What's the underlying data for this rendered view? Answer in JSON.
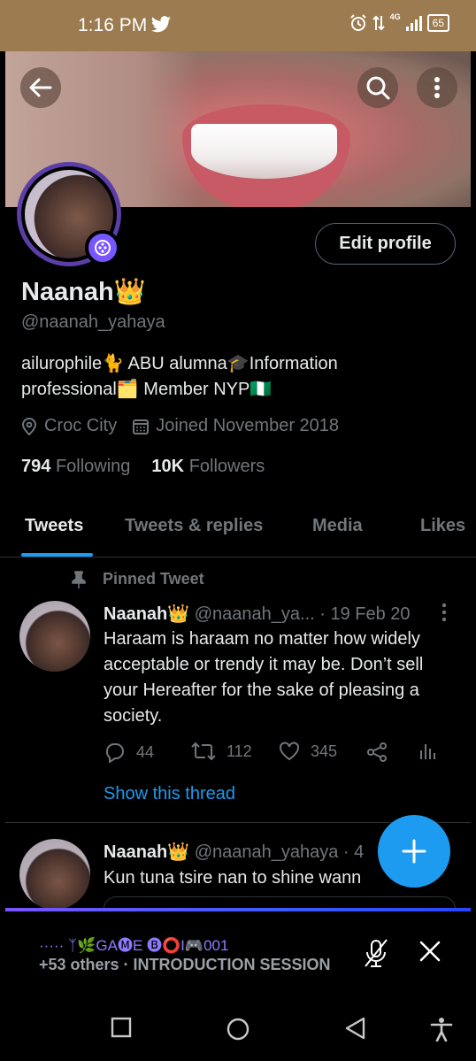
{
  "status_bar": {
    "time": "1:16 PM",
    "network": "4G",
    "battery": "65"
  },
  "profile": {
    "display_name": "Naanah👑",
    "handle": "@naanah_yahaya",
    "bio_line1": "ailurophile🐈 ABU alumna🎓Information",
    "bio_line2": "professional🗂️ Member NYP🇳🇬",
    "location": "Croc City",
    "joined": "Joined November 2018",
    "following_count": "794",
    "following_label": "Following",
    "followers_count": "10K",
    "followers_label": "Followers",
    "edit_profile_label": "Edit profile"
  },
  "tabs": [
    {
      "label": "Tweets"
    },
    {
      "label": "Tweets & replies"
    },
    {
      "label": "Media"
    },
    {
      "label": "Likes"
    }
  ],
  "pinned_label": "Pinned Tweet",
  "tweets": [
    {
      "name": "Naanah👑",
      "handle_date": "@naanah_ya... · 19 Feb 20",
      "text": "Haraam is haraam no matter how widely acceptable or trendy it may be. Don’t sell your Hereafter for the sake of pleasing a society.",
      "replies": "44",
      "retweets": "112",
      "likes": "345",
      "show_thread": "Show this thread"
    },
    {
      "name": "Naanah👑",
      "handle_date": "@naanah_yahaya · 4",
      "text": "Kun tuna tsire nan to shine wann"
    }
  ],
  "spaces": {
    "title": "····· ᛉ🌿GA🅜E 🅑⭕I🎮001",
    "subtitle": "+53 others · INTRODUCTION SESSION"
  },
  "colors": {
    "accent": "#1d9bf0",
    "spaces": "#7856ff",
    "status_bar": "#9b7b4f"
  }
}
